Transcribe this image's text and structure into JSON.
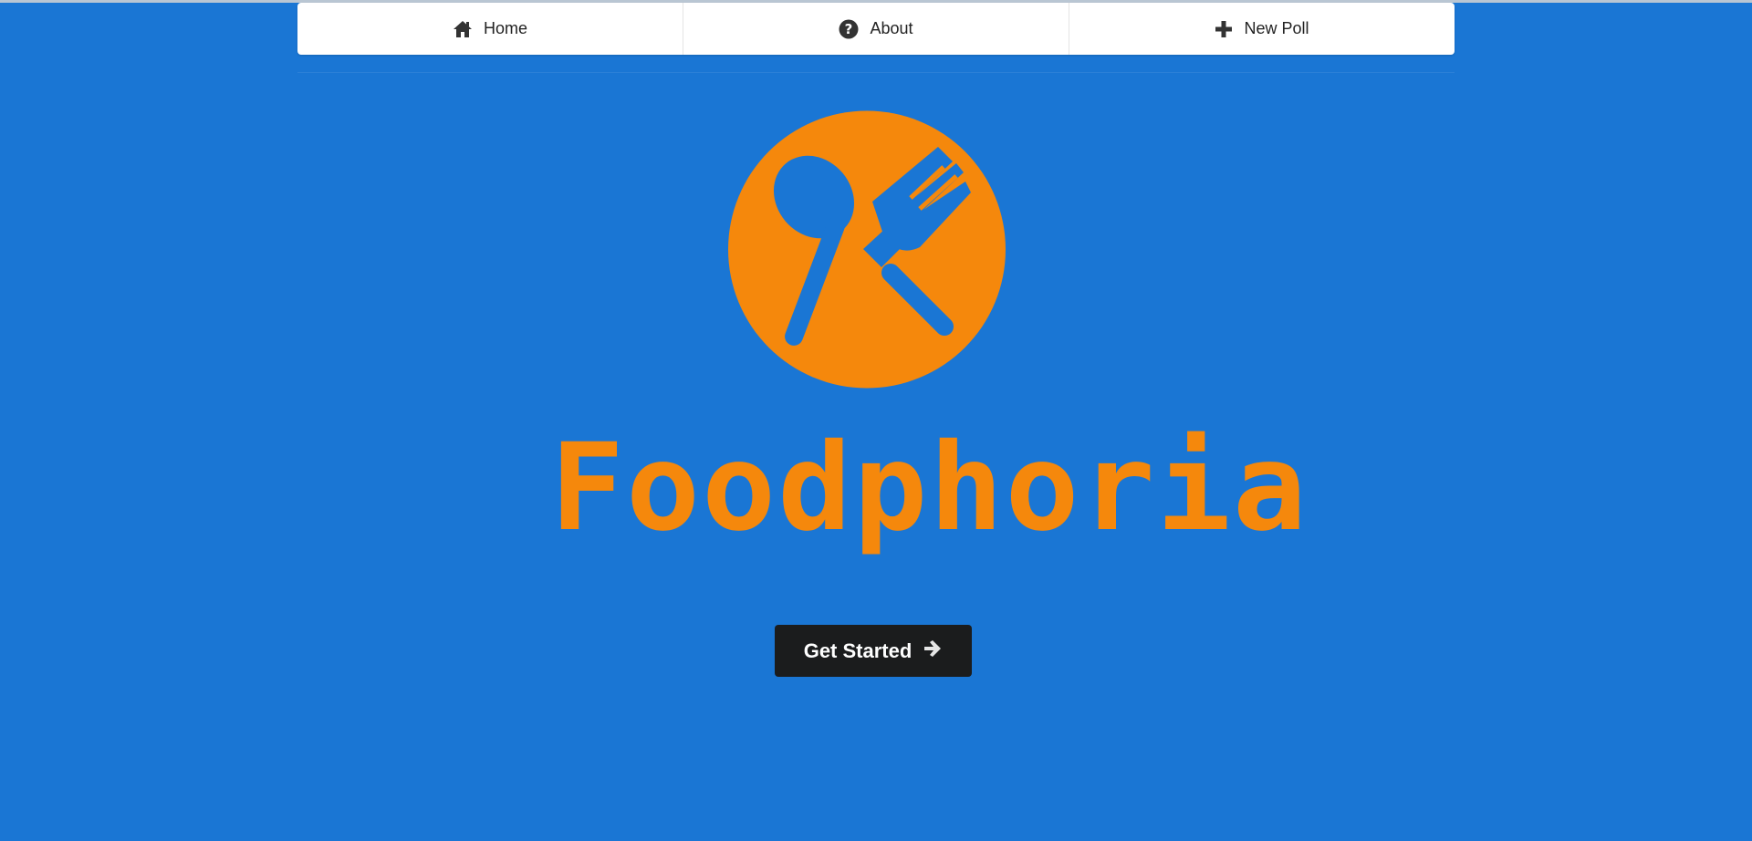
{
  "nav": {
    "items": [
      {
        "label": "Home",
        "icon": "home-icon"
      },
      {
        "label": "About",
        "icon": "question-circle-icon"
      },
      {
        "label": "New Poll",
        "icon": "plus-icon"
      }
    ]
  },
  "hero": {
    "logo_icon": "utensils-logo-icon",
    "brand_name": "Foodphoria",
    "cta_label": "Get Started",
    "cta_icon": "arrow-right-icon"
  },
  "colors": {
    "background": "#1a76d4",
    "accent": "#f5880c",
    "button": "#1b1c1d"
  }
}
